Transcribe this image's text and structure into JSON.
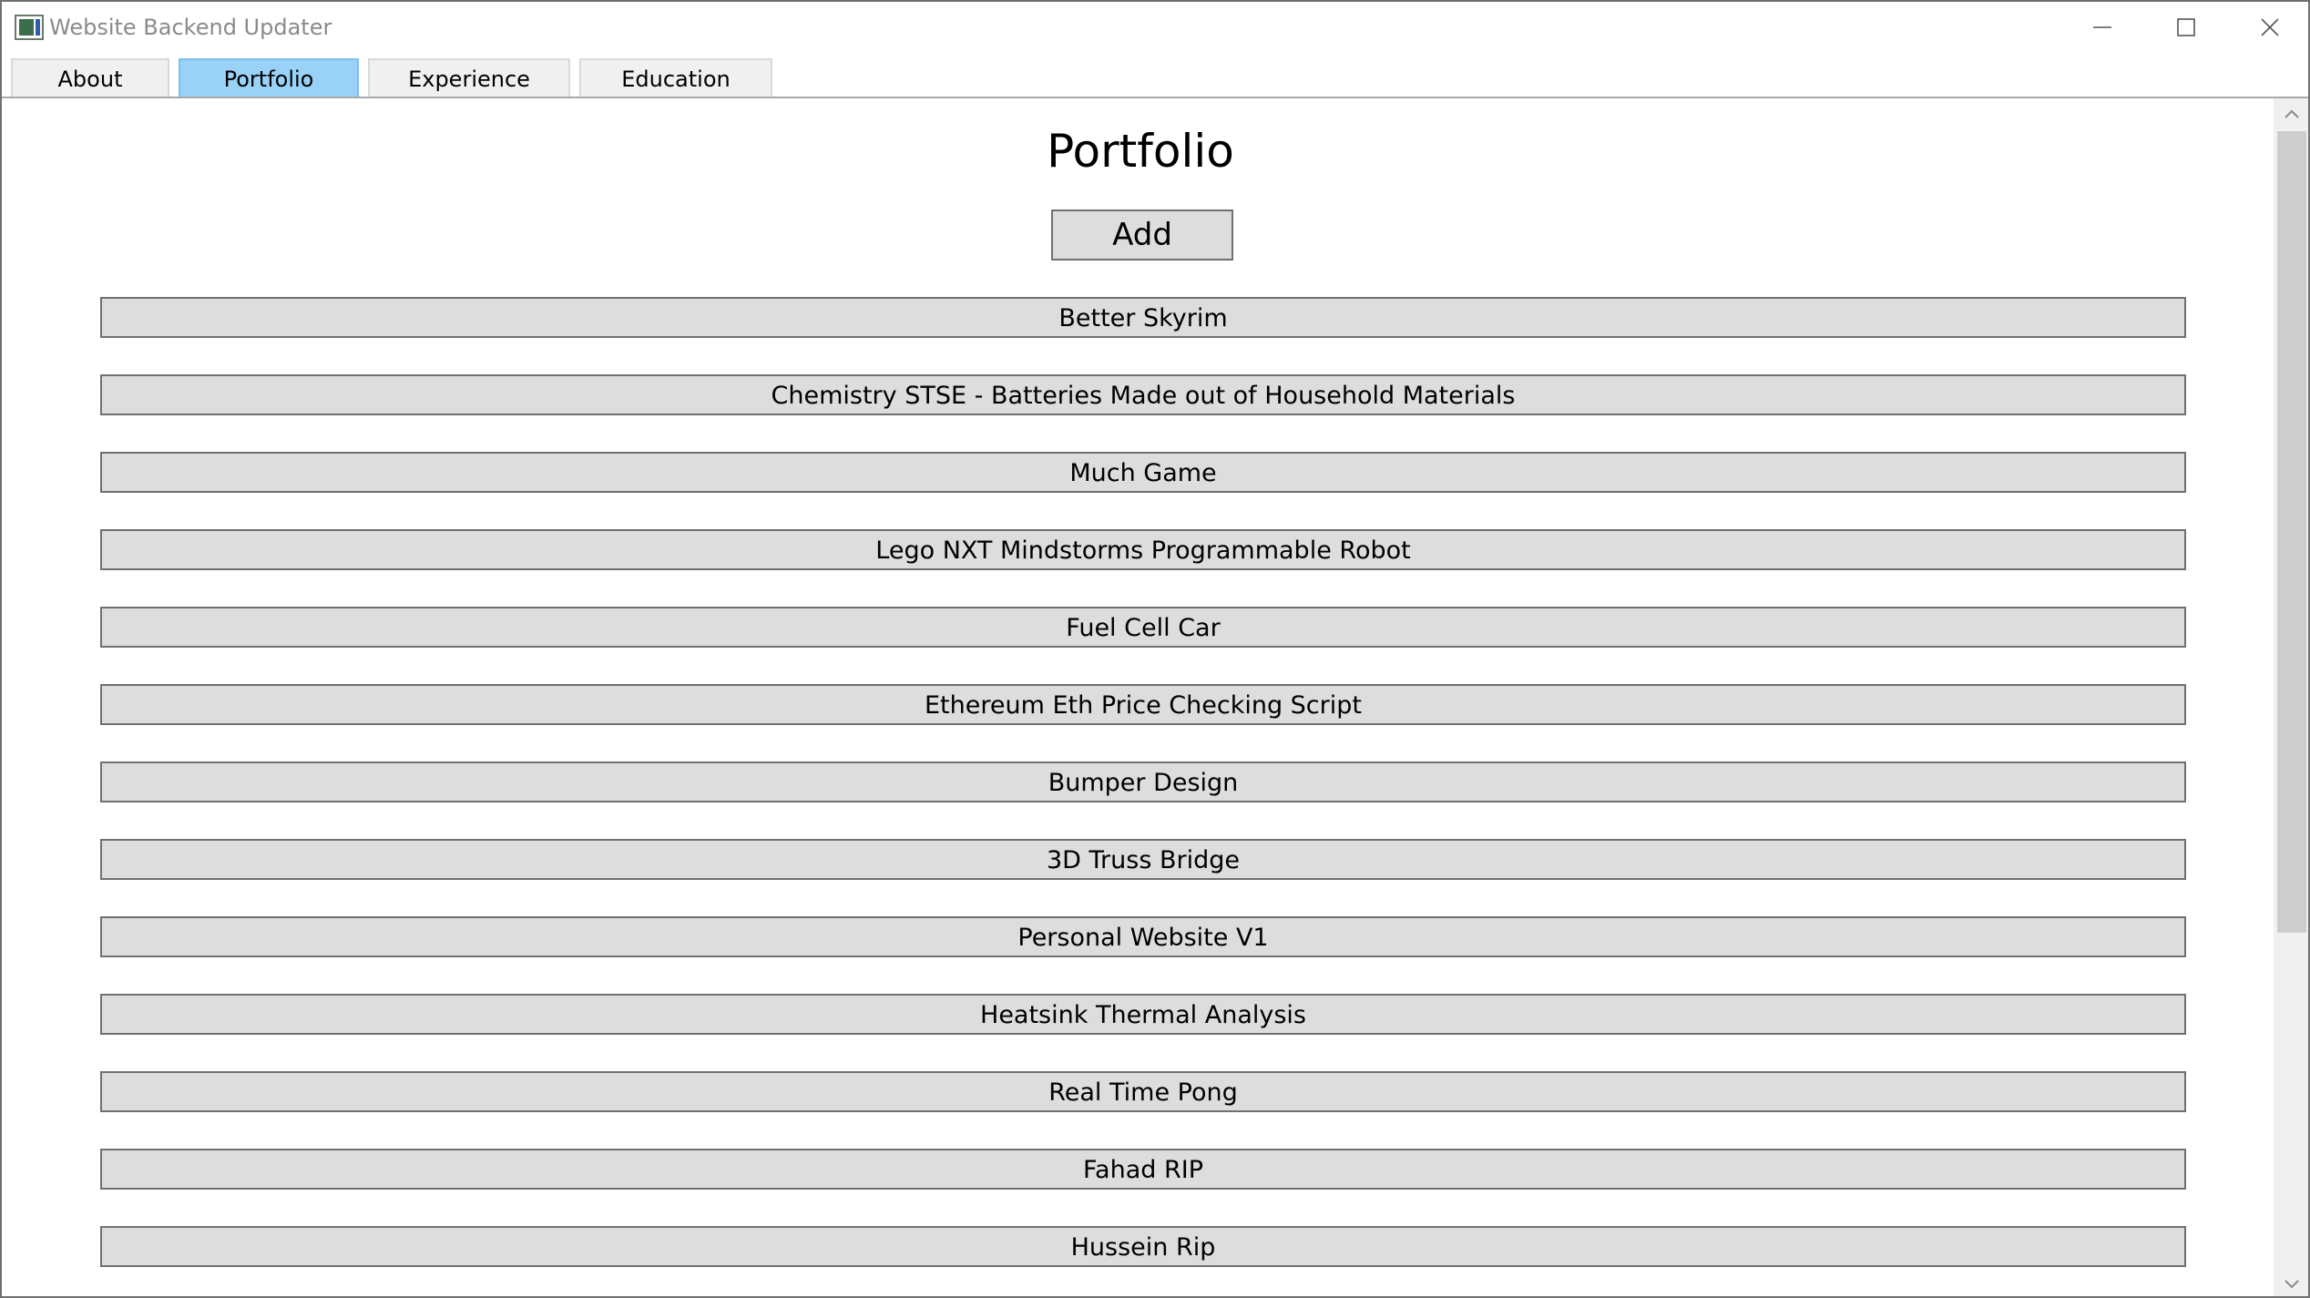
{
  "window": {
    "title": "Website Backend Updater"
  },
  "tabs": [
    {
      "label": "About",
      "active": false
    },
    {
      "label": "Portfolio",
      "active": true
    },
    {
      "label": "Experience",
      "active": false
    },
    {
      "label": "Education",
      "active": false
    }
  ],
  "main": {
    "heading": "Portfolio",
    "add_label": "Add",
    "items": [
      "Better Skyrim",
      "Chemistry STSE - Batteries Made out of Household Materials",
      "Much Game",
      "Lego NXT Mindstorms Programmable Robot",
      "Fuel Cell Car",
      "Ethereum Eth Price Checking Script",
      "Bumper Design",
      "3D Truss Bridge",
      "Personal Website V1",
      "Heatsink Thermal Analysis",
      "Real Time Pong",
      "Fahad RIP",
      "Hussein Rip"
    ]
  },
  "colors": {
    "active_tab": "#99d1f7",
    "button_face": "#dddddd",
    "button_border": "#707070"
  },
  "icons": {
    "app": "app-window-icon",
    "minimize": "minimize-icon",
    "maximize": "maximize-icon",
    "close": "close-icon",
    "scroll_up": "chevron-up-icon",
    "scroll_down": "chevron-down-icon"
  }
}
